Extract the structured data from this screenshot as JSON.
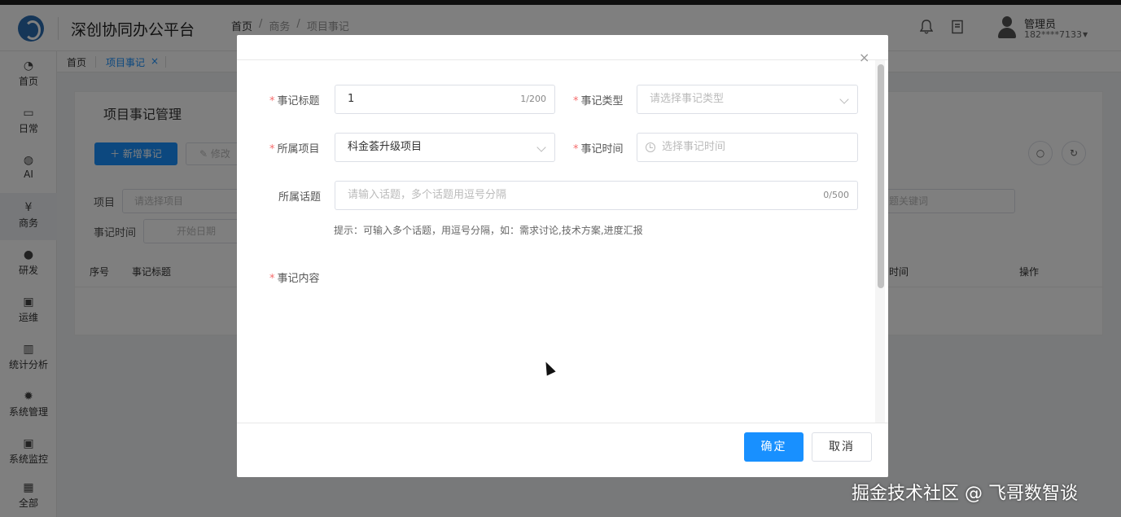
{
  "header": {
    "app_title": "深创协同办公平台",
    "breadcrumb": [
      "首页",
      "/",
      "商务",
      "/",
      "项目事记"
    ],
    "bell_icon": "bell-icon",
    "doc_icon": "document-icon",
    "user": {
      "name": "管理员",
      "phone": "182****7133",
      "caret": "▼"
    }
  },
  "sidebar": {
    "items": [
      {
        "label": "首页",
        "icon": "dashboard-icon",
        "glyph": "◔"
      },
      {
        "label": "日常",
        "icon": "calendar-icon",
        "glyph": "▭"
      },
      {
        "label": "AI",
        "icon": "globe-icon",
        "glyph": "◍"
      },
      {
        "label": "商务",
        "icon": "yen-icon",
        "glyph": "¥"
      },
      {
        "label": "研发",
        "icon": "people-icon",
        "glyph": "●"
      },
      {
        "label": "运维",
        "icon": "monitor-icon",
        "glyph": "▣"
      },
      {
        "label": "统计分析",
        "icon": "bar-chart-icon",
        "glyph": "▥"
      },
      {
        "label": "系统管理",
        "icon": "gear-icon",
        "glyph": "✹"
      },
      {
        "label": "系统监控",
        "icon": "monitor-icon",
        "glyph": "▣"
      },
      {
        "label": "全部",
        "icon": "grid-icon",
        "glyph": "▦"
      }
    ]
  },
  "tagbar": {
    "home": "首页",
    "active": "项目事记",
    "close": "×"
  },
  "card": {
    "title": "项目事记管理",
    "add_button": "＋ 新增事记",
    "edit_button": "✎ 修改",
    "filter_project_label": "项目",
    "filter_project_placeholder": "请选择项目",
    "filter_time_label": "事记时间",
    "filter_time_placeholder": "开始日期",
    "filter_keyword_placeholder": "题关键词",
    "search_glyph": "○",
    "refresh_glyph": "↻",
    "columns": {
      "seq": "序号",
      "title": "事记标题",
      "time": "时间",
      "ops": "操作"
    }
  },
  "dialog": {
    "close": "×",
    "fields": {
      "title": {
        "label": "事记标题",
        "value": "1",
        "count": "1/200"
      },
      "type": {
        "label": "事记类型",
        "placeholder": "请选择事记类型"
      },
      "project": {
        "label": "所属项目",
        "value": "科金荟升级项目"
      },
      "time": {
        "label": "事记时间",
        "placeholder": "选择事记时间"
      },
      "topic": {
        "label": "所属话题",
        "placeholder": "请输入话题，多个话题用逗号分隔",
        "count": "0/500"
      },
      "content": {
        "label": "事记内容"
      }
    },
    "hint": "提示：可输入多个话题，用逗号分隔，如：需求讨论,技术方案,进度汇报",
    "ok": "确定",
    "cancel": "取消"
  },
  "watermark": "掘金技术社区 @ 飞哥数智谈"
}
